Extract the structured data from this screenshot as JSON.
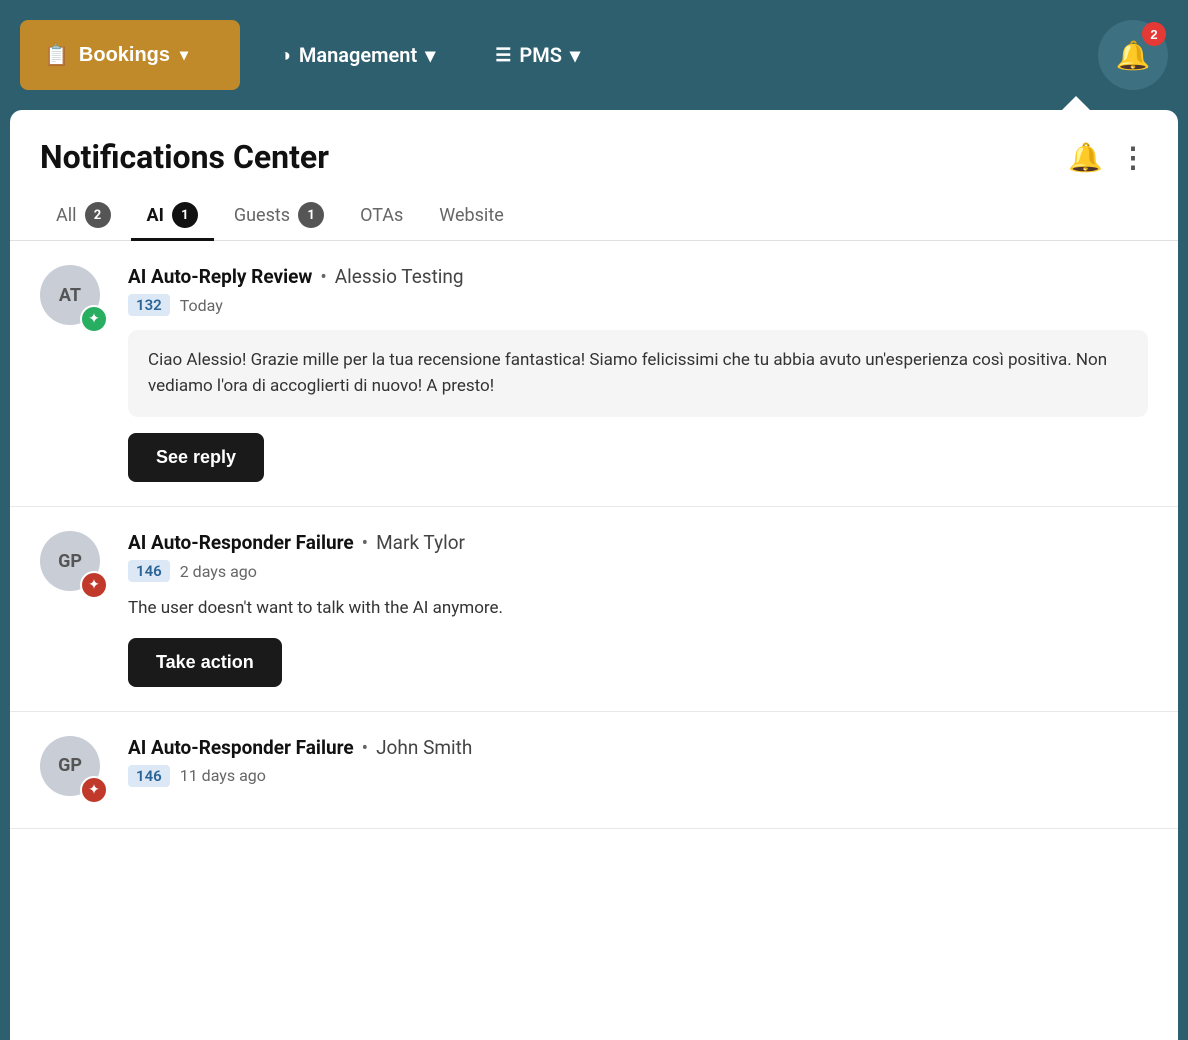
{
  "nav": {
    "bookings_label": "Bookings",
    "management_label": "Management",
    "pms_label": "PMS",
    "bell_badge": "2"
  },
  "panel": {
    "title": "Notifications Center",
    "bell_icon": "🔔",
    "dots_icon": "⋮"
  },
  "tabs": [
    {
      "id": "all",
      "label": "All",
      "badge": "2",
      "active": false
    },
    {
      "id": "ai",
      "label": "AI",
      "badge": "1",
      "active": true
    },
    {
      "id": "guests",
      "label": "Guests",
      "badge": "1",
      "active": false
    },
    {
      "id": "otas",
      "label": "OTAs",
      "badge": null,
      "active": false
    },
    {
      "id": "website",
      "label": "Website",
      "badge": null,
      "active": false
    }
  ],
  "notifications": [
    {
      "id": "notif-1",
      "avatar_initials": "AT",
      "avatar_badge_type": "green",
      "avatar_star": "✦",
      "title": "AI Auto-Reply Review",
      "separator": "•",
      "guest_name": "Alessio Testing",
      "id_badge": "132",
      "time": "Today",
      "message_type": "box",
      "message": "Ciao Alessio! Grazie mille per la tua recensione fantastica! Siamo felicissimi che tu abbia avuto un'esperienza così positiva. Non vediamo l'ora di accoglierti di nuovo! A presto!",
      "button_label": "See reply"
    },
    {
      "id": "notif-2",
      "avatar_initials": "GP",
      "avatar_badge_type": "red",
      "avatar_star": "✦",
      "title": "AI Auto-Responder Failure",
      "separator": "•",
      "guest_name": "Mark Tylor",
      "id_badge": "146",
      "time": "2 days ago",
      "message_type": "plain",
      "message": "The user doesn't want to talk with the AI anymore.",
      "button_label": "Take action"
    },
    {
      "id": "notif-3",
      "avatar_initials": "GP",
      "avatar_badge_type": "red",
      "avatar_star": "✦",
      "title": "AI Auto-Responder Failure",
      "separator": "•",
      "guest_name": "John Smith",
      "id_badge": "146",
      "time": "11 days ago",
      "message_type": "plain",
      "message": "",
      "button_label": ""
    }
  ]
}
